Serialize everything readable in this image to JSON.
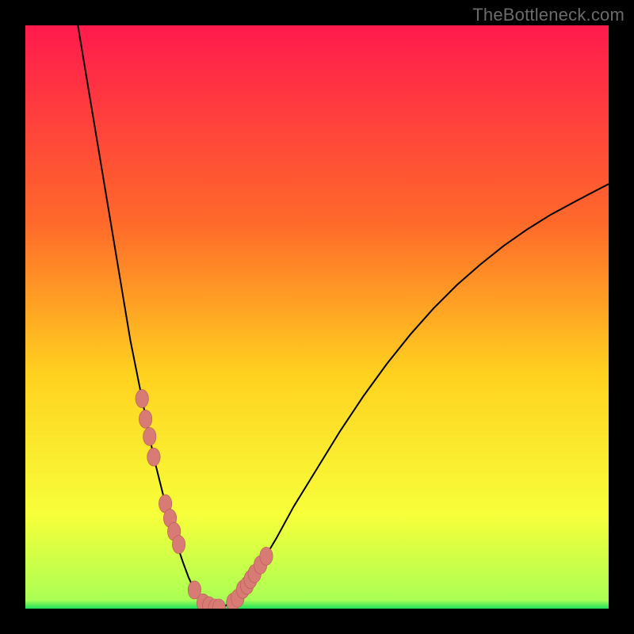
{
  "watermark": "TheBottleneck.com",
  "colors": {
    "bg_black": "#000000",
    "grad_top": "#ff1a4d",
    "grad_mid1": "#ff6a2a",
    "grad_mid2": "#ffd21f",
    "grad_mid3": "#f7ff3a",
    "grad_bottom": "#1fe05a",
    "curve": "#000000",
    "marker_fill": "#d77b74",
    "marker_stroke": "#b45a53",
    "watermark": "#6b6b6b"
  },
  "chart_data": {
    "type": "line",
    "title": "",
    "xlabel": "",
    "ylabel": "",
    "xlim": [
      0,
      100
    ],
    "ylim": [
      0,
      100
    ],
    "grid": false,
    "legend": false,
    "series": [
      {
        "name": "bottleneck-curve",
        "x": [
          9,
          10,
          11,
          12,
          13,
          14,
          15,
          16,
          17,
          18,
          19,
          20,
          21,
          22,
          23,
          24,
          25,
          26,
          27,
          28,
          29,
          30,
          31,
          32,
          34,
          36,
          38,
          40,
          43,
          46,
          50,
          54,
          58,
          62,
          66,
          70,
          74,
          78,
          82,
          86,
          90,
          95,
          100
        ],
        "y": [
          100,
          94,
          88,
          82,
          76,
          70,
          64,
          58,
          52,
          46,
          41,
          36,
          31,
          26,
          22,
          18,
          14.5,
          11,
          8,
          5.3,
          3.2,
          1.6,
          0.6,
          0.1,
          0.3,
          1.6,
          4,
          7,
          12,
          17.5,
          24,
          30.5,
          36.5,
          42,
          47,
          51.5,
          55.5,
          59,
          62.2,
          65,
          67.5,
          70.2,
          72.8
        ]
      }
    ],
    "markers": {
      "name": "highlighted-points",
      "x": [
        20,
        20.6,
        21.3,
        22,
        24,
        24.8,
        25.5,
        26.3,
        29,
        30.5,
        31.5,
        32.5,
        33.2,
        35.6,
        36.4,
        37.3,
        38,
        38.6,
        39.3,
        40.3,
        41.3
      ],
      "y": [
        36,
        32.5,
        29.5,
        26,
        18,
        15.5,
        13.2,
        11,
        3.2,
        1,
        0.5,
        0.1,
        0.1,
        1.1,
        1.8,
        3.3,
        4,
        5,
        6,
        7.5,
        9
      ]
    },
    "background_gradient": {
      "direction": "vertical",
      "stops": [
        {
          "pos": 0.0,
          "color": "#ff1a4d"
        },
        {
          "pos": 0.34,
          "color": "#ff6a2a"
        },
        {
          "pos": 0.6,
          "color": "#ffd21f"
        },
        {
          "pos": 0.84,
          "color": "#f7ff3a"
        },
        {
          "pos": 0.985,
          "color": "#aaff55"
        },
        {
          "pos": 1.0,
          "color": "#1fe05a"
        }
      ]
    }
  }
}
